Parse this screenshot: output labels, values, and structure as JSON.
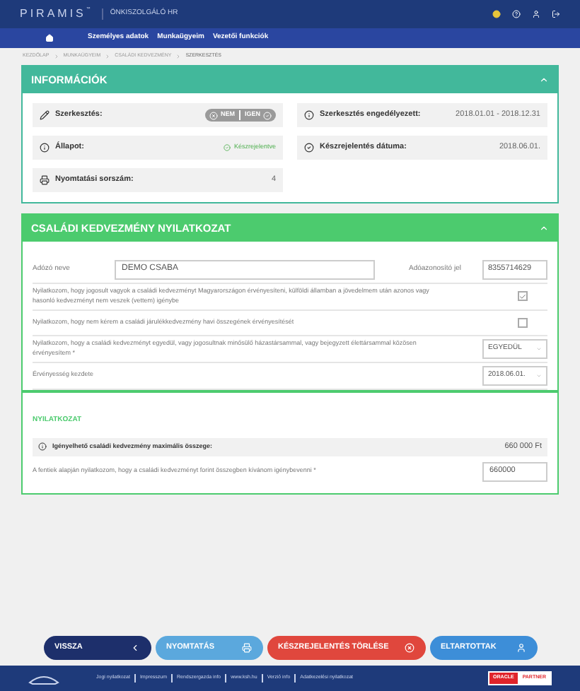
{
  "header": {
    "logo": "PIRAMIS",
    "logo_mark": "™",
    "product": "ÖNKISZOLGÁLÓ HR"
  },
  "nav": {
    "items": [
      {
        "label": "Személyes adatok"
      },
      {
        "label": "Munkaügyeim"
      },
      {
        "label": "Vezetői funkciók"
      }
    ]
  },
  "breadcrumb": [
    "KEZDŐLAP",
    "MUNKAÜGYEIM",
    "CSALÁDI KEDVEZMÉNY",
    "SZERKESZTÉS"
  ],
  "info": {
    "title": "INFORMÁCIÓK",
    "expanded": true,
    "left": [
      {
        "kind": "toggle",
        "label": "Szerkesztés:",
        "disabled": true,
        "options": [
          "NEM",
          "IGEN"
        ]
      },
      {
        "kind": "status",
        "label": "Állapot:",
        "value": "Készrejelentve"
      },
      {
        "kind": "text",
        "label": "Nyomtatási sorszám:",
        "value": "4"
      }
    ],
    "right": [
      {
        "kind": "text",
        "label": "Szerkesztés engedélyezett:",
        "value": "2018.01.01 - 2018.12.31"
      },
      {
        "kind": "text",
        "label": "Készrejelentés dátuma:",
        "value": "2018.06.01."
      }
    ]
  },
  "form": {
    "title": "CSALÁDI KEDVEZMÉNY NYILATKOZAT",
    "expanded": true,
    "name_label": "Adózó neve",
    "name_value": "DEMO CSABA",
    "tax_label": "Adóazonosító jel",
    "tax_value": "8355714629",
    "rows": [
      {
        "kind": "checkbox",
        "text": "Nyilatkozom, hogy jogosult vagyok a családi kedvezményt Magyarországon érvényesíteni, külföldi államban a jövedelmem után azonos vagy hasonló kedvezményt nem veszek (vettem) igénybe",
        "checked": true
      },
      {
        "kind": "checkbox",
        "text": "Nyilatkozom, hogy nem kérem a családi járulékkedvezmény havi összegének érvényesítését",
        "checked": false
      },
      {
        "kind": "select",
        "text": "Nyilatkozom, hogy a családi kedvezményt egyedül, vagy jogosultnak minősülő házastársammal, vagy bejegyzett élettársammal közösen érvényesítem *",
        "value": "EGYEDÜL"
      },
      {
        "kind": "select",
        "text": "Érvényesség kezdete",
        "value": "2018.06.01."
      }
    ],
    "section": {
      "title": "NYILATKOZAT",
      "max_label": "Igényelhető családi kedvezmény maximális összege:",
      "max_value": "660 000 Ft",
      "amount_label": "A fentiek alapján nyilatkozom, hogy a családi kedvezményt forint összegben kívánom igénybevenni *",
      "amount_value": "660000"
    }
  },
  "buttons": [
    {
      "label": "VISSZA",
      "color": "#1d2f6b"
    },
    {
      "label": "NYOMTATÁS",
      "color": "#5ba8dd"
    },
    {
      "label": "KÉSZREJELENTÉS TÖRLÉSE",
      "color": "#e0473d"
    },
    {
      "label": "ELTARTOTTAK",
      "color": "#3d8ed8"
    }
  ],
  "footer": {
    "links": [
      "Jogi nyilatkozat",
      "Impresszum",
      "Rendszergazda info",
      "www.ksh.hu",
      "Verzió info",
      "Adatkezelési nyilatkozat"
    ],
    "badge_left": "ORACLE",
    "badge_right": "PARTNER"
  }
}
